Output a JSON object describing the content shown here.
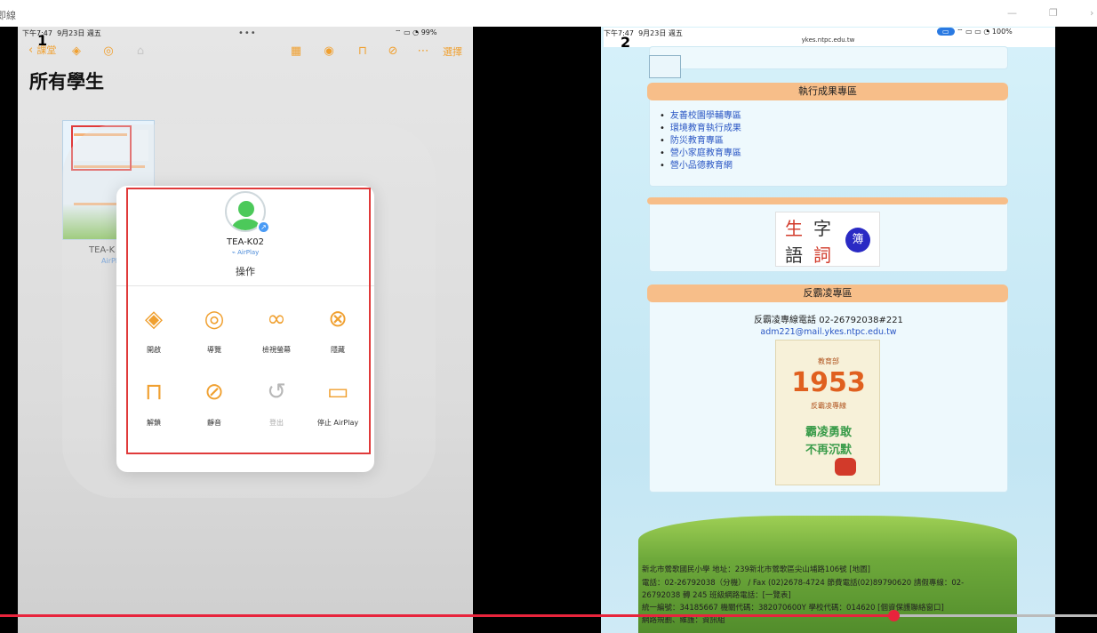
{
  "window": {
    "title": "即線"
  },
  "pane1": {
    "marker": "1",
    "status": {
      "time": "下午7:47",
      "date": "9月23日 週五",
      "battery": "99%"
    },
    "nav": {
      "back_label": "課堂",
      "choose_label": "選擇"
    },
    "heading": "所有學生",
    "thumb": {
      "name": "TEA-K",
      "sub": "AirPlay"
    },
    "dialog": {
      "device_name": "TEA-K02",
      "device_sub": "AirPlay",
      "section": "操作",
      "actions": [
        {
          "label": "開啟",
          "icon": "layers-icon",
          "enabled": true
        },
        {
          "label": "導覽",
          "icon": "compass-icon",
          "enabled": true
        },
        {
          "label": "檢視螢幕",
          "icon": "binoculars-icon",
          "enabled": true
        },
        {
          "label": "隱藏",
          "icon": "eye-slash-icon",
          "enabled": true
        },
        {
          "label": "解鎖",
          "icon": "unlock-icon",
          "enabled": true
        },
        {
          "label": "靜音",
          "icon": "mute-icon",
          "enabled": true
        },
        {
          "label": "登出",
          "icon": "logout-icon",
          "enabled": false
        },
        {
          "label": "停止 AirPlay",
          "icon": "airplay-icon",
          "enabled": true
        }
      ]
    }
  },
  "pane2": {
    "marker": "2",
    "status": {
      "time": "下午7:47",
      "date": "9月23日 週五",
      "battery": "100%"
    },
    "url": "ykes.ntpc.edu.tw",
    "section1": {
      "title": "執行成果專區",
      "links": [
        "友善校園學輔專區",
        "環境教育執行成果",
        "防災教育專區",
        "營小家庭教育專區",
        "營小品德教育網"
      ]
    },
    "banner": {
      "chars": [
        "生",
        "字",
        "語",
        "詞"
      ],
      "badge": "簿"
    },
    "section2": {
      "title": "反霸凌專區",
      "hotline": "反霸凌專線電話 02-26792038#221",
      "email": "adm221@mail.ykes.ntpc.edu.tw",
      "poster": {
        "top": "教育部",
        "num": "1953",
        "sub": "反霸凌專線",
        "slogan1": "霸凌勇敢",
        "slogan2": "不再沉默"
      }
    },
    "footer": [
      "新北市鶯歌國民小學  地址：239新北市鶯歌區尖山埔路106號 [地圖]",
      "電話：02-26792038（分機）  / Fax (02)2678-4724   節費電話(02)89790620  請假專線：02-",
      "26792038 轉 245  班級網路電話：[一覽表]",
      "統一編號：34185667  機關代碼：382070600Y  學校代碼：014620  [個資保護聯絡窗口]",
      "網路規劃、維護：資訊組"
    ]
  },
  "video": {
    "progress": 0.815
  }
}
